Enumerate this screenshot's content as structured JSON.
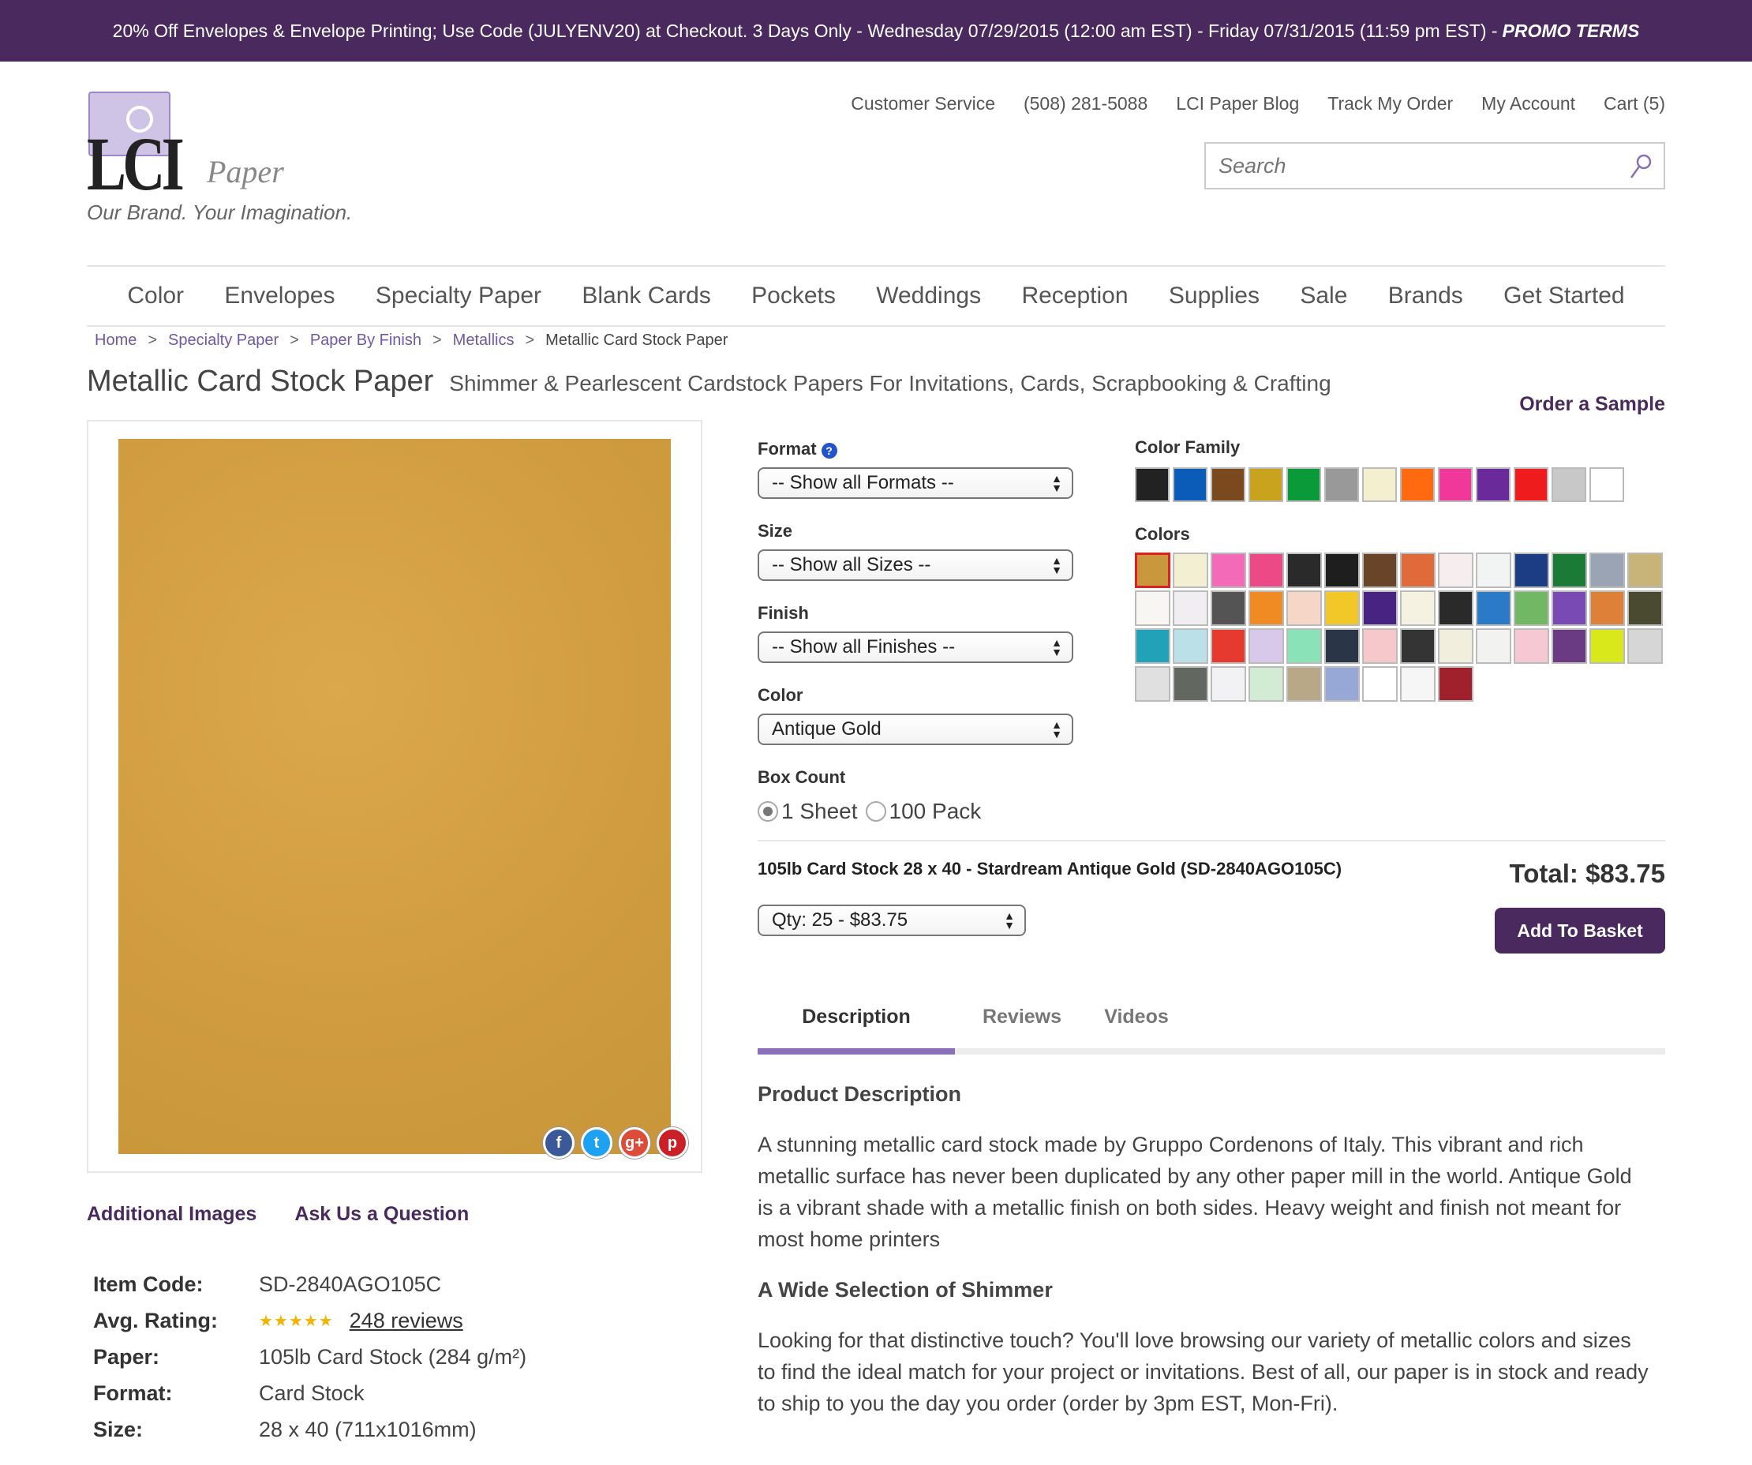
{
  "promo": {
    "text": "20% Off Envelopes & Envelope Printing; Use Code (JULYENV20) at Checkout. 3 Days Only - Wednesday 07/29/2015 (12:00 am EST) - Friday 07/31/2015 (11:59 pm EST) -",
    "terms": "PROMO TERMS"
  },
  "logo": {
    "brand": "LCI",
    "paper": "Paper",
    "tagline": "Our Brand. Your Imagination."
  },
  "util": [
    "Customer Service",
    "(508) 281-5088",
    "LCI Paper Blog",
    "Track My Order",
    "My Account",
    "Cart (5)"
  ],
  "search": {
    "placeholder": "Search"
  },
  "nav": [
    "Color",
    "Envelopes",
    "Specialty Paper",
    "Blank Cards",
    "Pockets",
    "Weddings",
    "Reception",
    "Supplies",
    "Sale",
    "Brands",
    "Get Started"
  ],
  "breadcrumb": {
    "items": [
      "Home",
      "Specialty Paper",
      "Paper By Finish",
      "Metallics"
    ],
    "current": "Metallic Card Stock Paper",
    "sep": ">"
  },
  "title": "Metallic Card Stock Paper",
  "subtitle": "Shimmer & Pearlescent Cardstock Papers For Invitations, Cards, Scrapbooking & Crafting",
  "order_sample": "Order a Sample",
  "image_links": {
    "additional": "Additional Images",
    "ask": "Ask Us a Question"
  },
  "social": [
    "f",
    "t",
    "g+",
    "p"
  ],
  "specs": {
    "item_code_label": "Item Code:",
    "item_code": "SD-2840AGO105C",
    "rating_label": "Avg. Rating:",
    "stars": "★★★★★",
    "reviews": "248 reviews",
    "paper_label": "Paper:",
    "paper": "105lb Card Stock (284 g/m²)",
    "format_label": "Format:",
    "format": "Card Stock",
    "size_label": "Size:",
    "size": "28 x 40 (711x1016mm)"
  },
  "options": {
    "format_label": "Format",
    "format_value": "-- Show all Formats --",
    "size_label": "Size",
    "size_value": "-- Show all Sizes --",
    "finish_label": "Finish",
    "finish_value": "-- Show all Finishes --",
    "color_label": "Color",
    "color_value": "Antique Gold",
    "box_label": "Box Count",
    "box_options": [
      "1 Sheet",
      "100 Pack"
    ]
  },
  "color_family_label": "Color Family",
  "color_family": [
    "#222222",
    "#0a5cb8",
    "#7a4a1e",
    "#c9a21e",
    "#0a9a3a",
    "#999999",
    "#f3efcf",
    "#ff6a10",
    "#f0389a",
    "#6a2a9a",
    "#ee1c1c",
    "#c8c8c8",
    "#ffffff"
  ],
  "colors_label": "Colors",
  "colors": [
    "#c9983c",
    "#f2efd2",
    "#f26ab8",
    "#ec4a86",
    "#2a2a2a",
    "#1e1e1e",
    "#6a4428",
    "#e06a3a",
    "#f6eeee",
    "#f2f4f4",
    "#1c3c84",
    "#1a7a36",
    "#9aa4b4",
    "#c8b478",
    "#f8f6f2",
    "#f0eef0",
    "#545454",
    "#f08a22",
    "#f6d6c6",
    "#f2c828",
    "#482482",
    "#f6f2e2",
    "#2a2a2a",
    "#2a7ac8",
    "#72b864",
    "#7a4ab4",
    "#de8038",
    "#4a4a30",
    "#22a2b8",
    "#bce0e8",
    "#e63a30",
    "#d8c8ea",
    "#8ae2b8",
    "#2a3648",
    "#f6c8cc",
    "#343434",
    "#f2eede",
    "#f2f2f0",
    "#f6c8d4",
    "#6a3a82",
    "#d8e81a",
    "#d6d6d6",
    "#e0e0e0",
    "#626860",
    "#f2f2f4",
    "#d2ecd4",
    "#b8a888",
    "#98a8d6",
    "#ffffff",
    "#f6f6f6",
    "#a0202c"
  ],
  "product": {
    "name": "105lb Card Stock 28 x 40 - Stardream Antique Gold (SD-2840AGO105C)",
    "total": "Total: $83.75",
    "qty": "Qty: 25 - $83.75",
    "add_button": "Add To Basket"
  },
  "tabs": [
    "Description",
    "Reviews",
    "Videos"
  ],
  "description": {
    "heading1": "Product Description",
    "p1": "A stunning metallic card stock made by Gruppo Cordenons of Italy. This vibrant and rich metallic surface has never been duplicated by any other paper mill in the world. Antique Gold is a vibrant shade with a metallic finish on both sides. Heavy weight and finish not meant for most home printers",
    "heading2": "A Wide Selection of Shimmer",
    "p2": "Looking for that distinctive touch? You'll love browsing our variety of metallic colors and sizes to find the ideal match for your project or invitations. Best of all, our paper is in stock and ready to ship to you the day you order (order by 3pm EST, Mon-Fri)."
  }
}
